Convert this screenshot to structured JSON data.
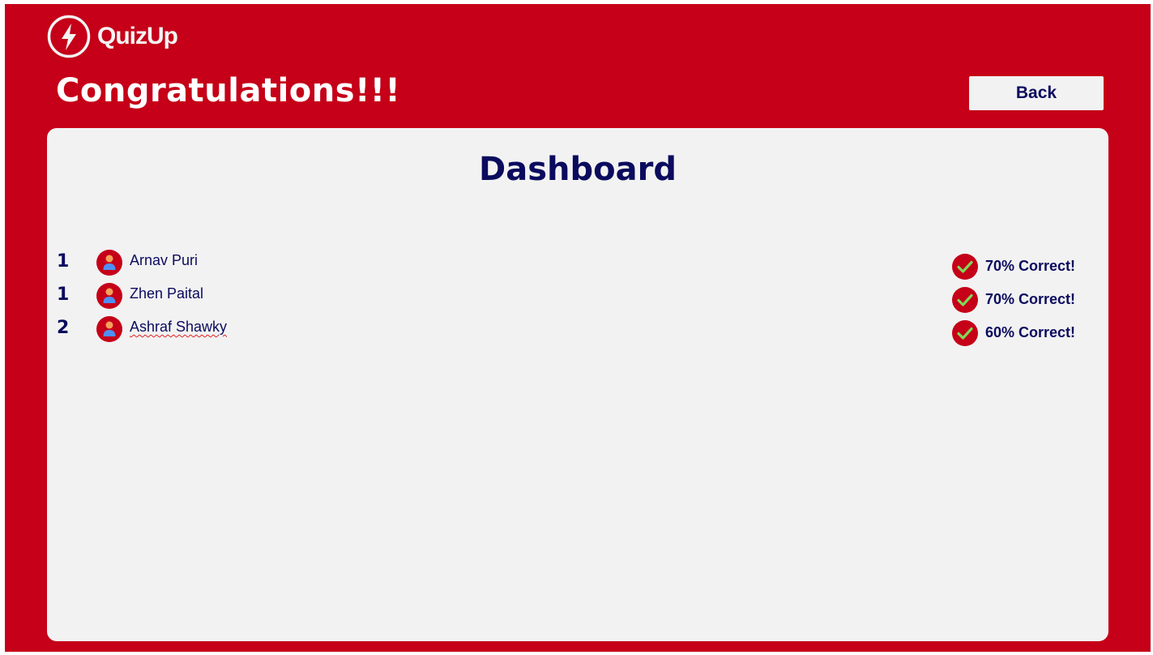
{
  "app": {
    "brand": "QuizUp",
    "logo_icon": "lightning-bolt-icon",
    "headline": "Congratulations!!!",
    "back_label": "Back",
    "colors": {
      "brand_red": "#c50018",
      "panel": "#f2f2f2",
      "text_navy": "#0b0b5e",
      "check_green": "#7ed957"
    }
  },
  "dashboard": {
    "title": "Dashboard",
    "players": [
      {
        "rank": "1",
        "name": "Arnav Puri",
        "score": "70% Correct!",
        "avatar_icon": "user-avatar-icon",
        "score_icon": "checkmark-icon"
      },
      {
        "rank": "1",
        "name": "Zhen Paital",
        "score": "70% Correct!",
        "avatar_icon": "user-avatar-icon",
        "score_icon": "checkmark-icon"
      },
      {
        "rank": "2",
        "name": "Ashraf Shawky",
        "score": "60% Correct!",
        "avatar_icon": "user-avatar-icon",
        "score_icon": "checkmark-icon"
      }
    ]
  }
}
